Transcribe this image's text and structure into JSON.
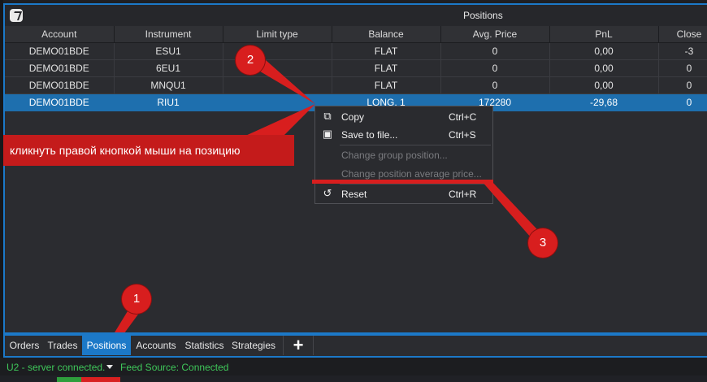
{
  "window": {
    "title": "Positions"
  },
  "table": {
    "columns": [
      "Account",
      "Instrument",
      "Limit type",
      "Balance",
      "Avg. Price",
      "PnL",
      "Close"
    ],
    "rows": [
      [
        "DEMO01BDE",
        "ESU1",
        "",
        "FLAT",
        "0",
        "0,00",
        "-3"
      ],
      [
        "DEMO01BDE",
        "6EU1",
        "",
        "FLAT",
        "0",
        "0,00",
        "0"
      ],
      [
        "DEMO01BDE",
        "MNQU1",
        "",
        "FLAT",
        "0",
        "0,00",
        "0"
      ],
      [
        "DEMO01BDE",
        "RIU1",
        "",
        "LONG, 1",
        "172280",
        "-29,68",
        "0"
      ]
    ]
  },
  "context_menu": {
    "items": [
      {
        "label": "Copy",
        "shortcut": "Ctrl+C",
        "icon": "copy-icon"
      },
      {
        "label": "Save to file...",
        "shortcut": "Ctrl+S",
        "icon": "save-icon"
      },
      {
        "label": "Change group position...",
        "shortcut": ""
      },
      {
        "label": "Change position average price...",
        "shortcut": ""
      },
      {
        "label": "Reset",
        "shortcut": "Ctrl+R",
        "icon": "reset-icon"
      }
    ]
  },
  "annotation": {
    "callout": "кликнуть правой кнопкой мыши на позицию",
    "badges": [
      "1",
      "2",
      "3"
    ]
  },
  "tabs": [
    "Orders",
    "Trades",
    "Positions",
    "Accounts",
    "Statistics",
    "Strategies"
  ],
  "add_tab_label": "+",
  "status": {
    "server": "U2 - server connected.",
    "feed": "Feed Source: Connected"
  },
  "colors": {
    "accent": "#1c79c8",
    "selection": "#1e6fae",
    "annotation": "#d81e1e",
    "status_ok": "#3fc75a"
  }
}
